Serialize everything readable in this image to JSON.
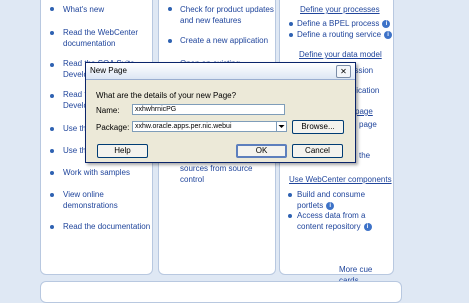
{
  "col1": {
    "items": [
      {
        "label": "What's new"
      },
      {
        "label": "Read the WebCenter documentation"
      },
      {
        "label": "Read the SOA Suite Developer's Guide"
      },
      {
        "label": "Read the ADF Developer's Guide"
      },
      {
        "label": "Use the Tutorial"
      },
      {
        "label": "Use the Sample"
      },
      {
        "label": "Work with samples"
      },
      {
        "label": "View online demonstrations"
      },
      {
        "label": "Read the documentation"
      }
    ]
  },
  "col2": {
    "items": [
      {
        "label": "Check for product updates and new features"
      },
      {
        "label": "Create a new application"
      },
      {
        "label": "Open an existing"
      }
    ],
    "bottom_text": "sources from source control"
  },
  "col3": {
    "header1": "Define your processes",
    "items1": [
      {
        "label": "Define a BPEL process"
      },
      {
        "label": "Define a routing service"
      }
    ],
    "header2": "Define your data model",
    "partials": [
      "ession",
      "plication",
      "page",
      "page",
      "the"
    ],
    "header3": "Use WebCenter components",
    "items3": [
      {
        "label": "Build and consume portlets"
      },
      {
        "label": "Access data from a content repository"
      }
    ],
    "more_link": "More cue cards"
  },
  "dialog": {
    "title": "New Page",
    "prompt": "What are the details of your new Page?",
    "name_label": "Name:",
    "name_value": "xxhwhrnicPG",
    "package_label": "Package:",
    "package_value": "xxhw.oracle.apps.per.nic.webui",
    "browse_label": "Browse...",
    "help_label": "Help",
    "ok_label": "OK",
    "cancel_label": "Cancel",
    "close_glyph": "✕"
  },
  "colors": {
    "link": "#21469c",
    "background": "#dfe8f4",
    "dialog_bg": "#ece9d8"
  },
  "icons": [
    "info-icon",
    "close-icon",
    "dropdown-arrow-icon",
    "bullet-icon"
  ]
}
